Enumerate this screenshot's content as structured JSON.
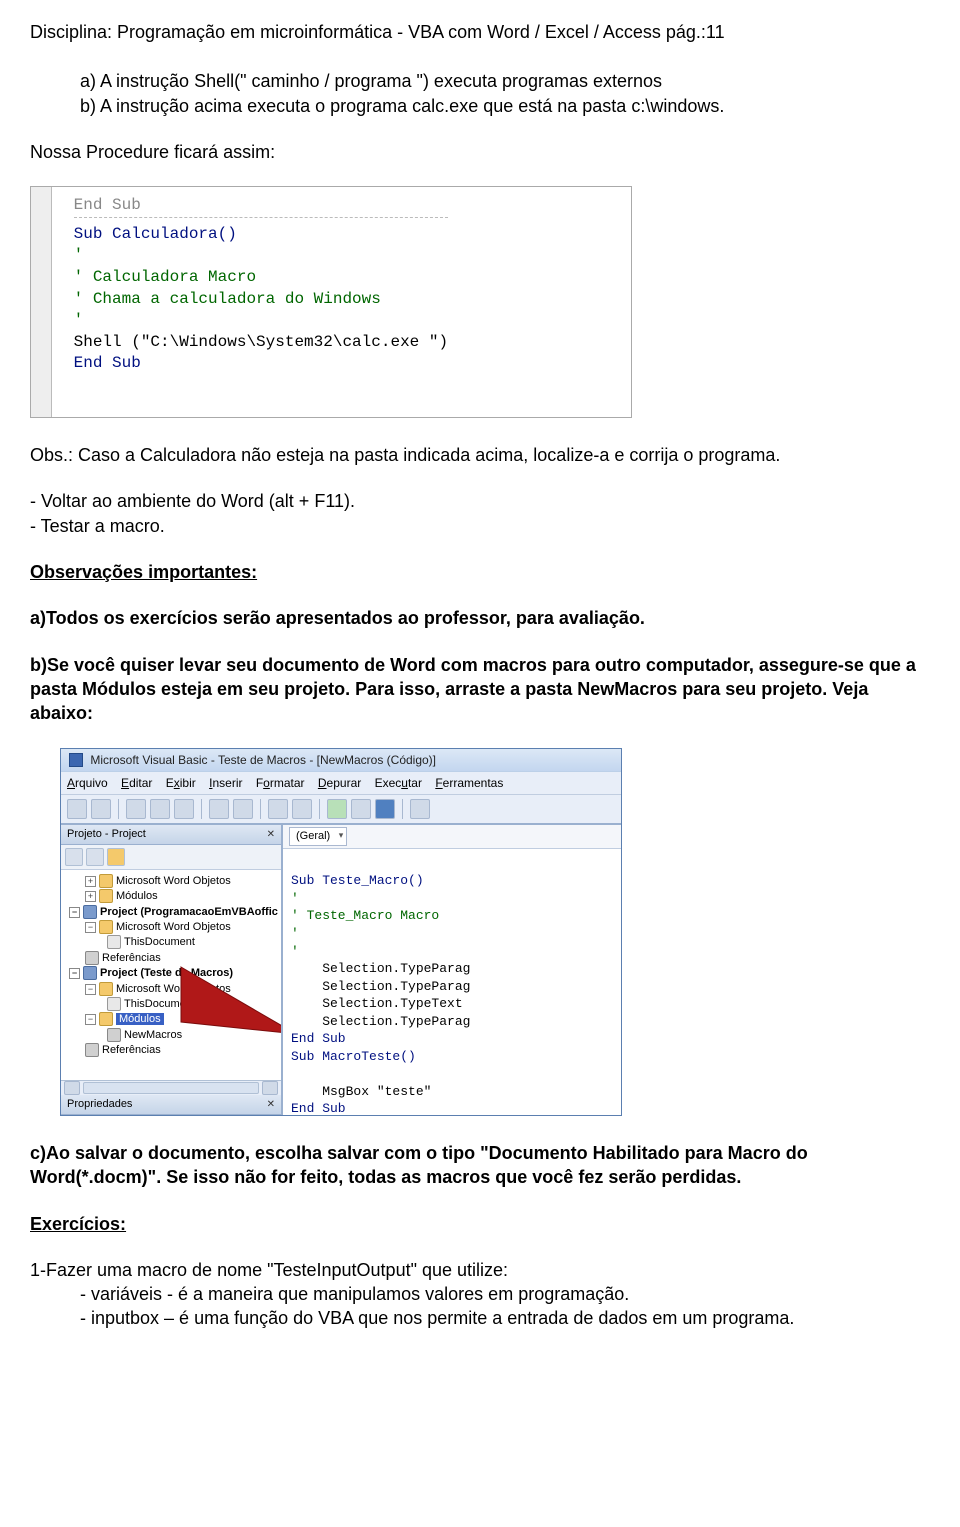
{
  "header": "Disciplina: Programação em microinformática  -  VBA com Word / Excel / Access   pág.:11",
  "item_a": "a) A instrução Shell(\" caminho / programa \") executa programas externos",
  "item_b": "b)  A instrução acima executa o programa calc.exe que está na pasta c:\\windows.",
  "nossa": "Nossa Procedure ficará assim:",
  "code1": {
    "line_top": "End Sub",
    "l1": "Sub Calculadora()",
    "l2": "'",
    "l3": "' Calculadora Macro",
    "l4": "' Chama a calculadora do Windows",
    "l5": "'",
    "l6": "Shell (\"C:\\Windows\\System32\\calc.exe \")",
    "l7": "",
    "l8": "End Sub"
  },
  "obs": "Obs.: Caso a Calculadora não esteja na pasta indicada acima, localize-a e corrija o programa.",
  "voltar": "- Voltar ao ambiente do Word (alt + F11).",
  "testar": "- Testar a macro.",
  "observacoes_title": "Observações importantes:",
  "obs_a": "a)Todos os exercícios serão apresentados ao professor, para avaliação.",
  "obs_b": "b)Se você quiser levar seu documento de Word com macros para outro computador, assegure-se que a pasta Módulos esteja em seu projeto. Para isso, arraste a pasta NewMacros para seu projeto. Veja abaixo:",
  "ide": {
    "title": "Microsoft Visual Basic - Teste de Macros - [NewMacros (Código)]",
    "menu": [
      "Arquivo",
      "Editar",
      "Exibir",
      "Inserir",
      "Formatar",
      "Depurar",
      "Executar",
      "Ferramentas"
    ],
    "panel_project": "Projeto - Project",
    "tree": {
      "t1": "Microsoft Word Objetos",
      "t2": "Módulos",
      "t3": "Project (ProgramacaoEmVBAoffic",
      "t3a": "Microsoft Word Objetos",
      "t3b": "ThisDocument",
      "t3c": "Referências",
      "t4": "Project (Teste de Macros)",
      "t4a": "Microsoft Word Objetos",
      "t4b": "ThisDocument",
      "t4c": "Módulos",
      "t4d": "NewMacros",
      "t4e": "Referências"
    },
    "props": "Propriedades",
    "combo": "(Geral)",
    "code": {
      "l1": "Sub Teste_Macro()",
      "l2": "'",
      "l3": "' Teste_Macro Macro",
      "l4": "'",
      "l5": "'",
      "l6": "    Selection.TypeParag",
      "l7": "    Selection.TypeParag",
      "l8": "    Selection.TypeText",
      "l9": "    Selection.TypeParag",
      "l10": "End Sub",
      "l11": "Sub MacroTeste()",
      "l12": "    MsgBox \"teste\"",
      "l13": "End Sub"
    }
  },
  "obs_c": "c)Ao salvar o documento, escolha salvar com o tipo \"Documento Habilitado para Macro do Word(*.docm)\".  Se isso não for feito, todas as macros que você fez serão perdidas.",
  "exercicios": "Exercícios:",
  "ex1": "1-Fazer uma macro de nome \"TesteInputOutput\" que utilize:",
  "ex1a": "- variáveis - é a maneira que manipulamos valores em programação.",
  "ex1b": "- inputbox – é uma função do VBA que nos permite a entrada de dados em um programa."
}
